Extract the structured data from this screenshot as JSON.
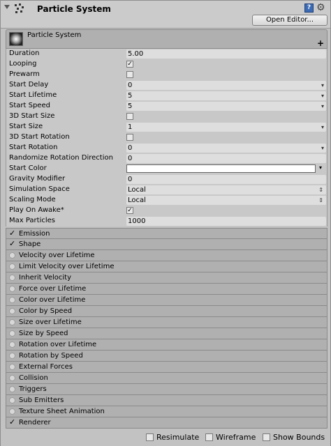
{
  "header": {
    "title": "Particle System",
    "open_editor_label": "Open Editor...",
    "help_glyph": "?",
    "gear_glyph": "⚙"
  },
  "main_module": {
    "title": "Particle System",
    "plus_glyph": "+"
  },
  "properties": [
    {
      "label": "Duration",
      "type": "text",
      "value": "5.00"
    },
    {
      "label": "Looping",
      "type": "checkbox",
      "checked": true
    },
    {
      "label": "Prewarm",
      "type": "checkbox",
      "checked": false
    },
    {
      "label": "Start Delay",
      "type": "dropdown",
      "value": "0"
    },
    {
      "label": "Start Lifetime",
      "type": "dropdown",
      "value": "5"
    },
    {
      "label": "Start Speed",
      "type": "dropdown",
      "value": "5"
    },
    {
      "label": "3D Start Size",
      "type": "checkbox",
      "checked": false
    },
    {
      "label": "Start Size",
      "type": "dropdown",
      "value": "1"
    },
    {
      "label": "3D Start Rotation",
      "type": "checkbox",
      "checked": false
    },
    {
      "label": "Start Rotation",
      "type": "dropdown",
      "value": "0"
    },
    {
      "label": "Randomize Rotation Direction",
      "type": "text",
      "value": "0"
    },
    {
      "label": "Start Color",
      "type": "color",
      "value": "#ffffff"
    },
    {
      "label": "Gravity Modifier",
      "type": "text",
      "value": "0"
    },
    {
      "label": "Simulation Space",
      "type": "popup",
      "value": "Local"
    },
    {
      "label": "Scaling Mode",
      "type": "popup",
      "value": "Local"
    },
    {
      "label": "Play On Awake*",
      "type": "checkbox",
      "checked": true
    },
    {
      "label": "Max Particles",
      "type": "text",
      "value": "1000"
    }
  ],
  "modules": [
    {
      "label": "Emission",
      "enabled": true
    },
    {
      "label": "Shape",
      "enabled": true
    },
    {
      "label": "Velocity over Lifetime",
      "enabled": false
    },
    {
      "label": "Limit Velocity over Lifetime",
      "enabled": false
    },
    {
      "label": "Inherit Velocity",
      "enabled": false
    },
    {
      "label": "Force over Lifetime",
      "enabled": false
    },
    {
      "label": "Color over Lifetime",
      "enabled": false
    },
    {
      "label": "Color by Speed",
      "enabled": false
    },
    {
      "label": "Size over Lifetime",
      "enabled": false
    },
    {
      "label": "Size by Speed",
      "enabled": false
    },
    {
      "label": "Rotation over Lifetime",
      "enabled": false
    },
    {
      "label": "Rotation by Speed",
      "enabled": false
    },
    {
      "label": "External Forces",
      "enabled": false
    },
    {
      "label": "Collision",
      "enabled": false
    },
    {
      "label": "Triggers",
      "enabled": false
    },
    {
      "label": "Sub Emitters",
      "enabled": false
    },
    {
      "label": "Texture Sheet Animation",
      "enabled": false
    },
    {
      "label": "Renderer",
      "enabled": true
    }
  ],
  "footer": {
    "resimulate_label": "Resimulate",
    "resimulate_checked": false,
    "wireframe_label": "Wireframe",
    "wireframe_checked": false,
    "show_bounds_label": "Show Bounds",
    "show_bounds_checked": false
  },
  "check_glyph": "✓"
}
